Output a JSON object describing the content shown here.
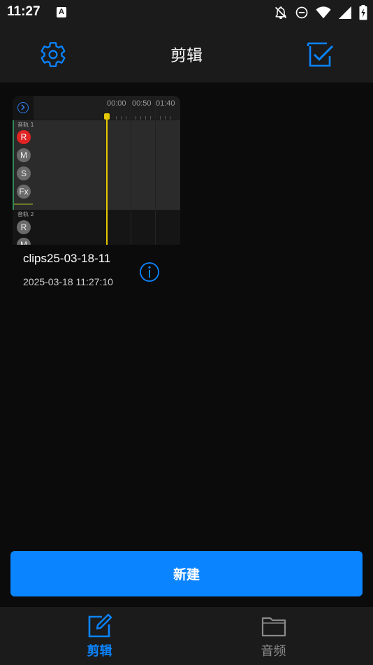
{
  "status_bar": {
    "time": "11:27",
    "notification_icon_letter": "A",
    "icons": [
      "notifications-off-icon",
      "do-not-disturb-icon",
      "wifi-icon",
      "signal-icon",
      "battery-charging-icon"
    ]
  },
  "header": {
    "title": "剪辑",
    "left_icon": "settings-gear-icon",
    "right_icon": "select-multiple-icon"
  },
  "projects": [
    {
      "name": "clips25-03-18-11",
      "date": "2025-03-18 11:27:10",
      "thumbnail": {
        "ruler_labels": [
          "00:00",
          "00:50",
          "01:40"
        ],
        "track1_label": "音轨 1",
        "track2_label": "音轨 2",
        "track1_buttons": [
          "R",
          "M",
          "S",
          "Fx"
        ],
        "track2_buttons": [
          "R",
          "M"
        ]
      }
    }
  ],
  "actions": {
    "new_label": "新建"
  },
  "bottom_nav": [
    {
      "label": "剪辑",
      "icon": "edit-icon",
      "active": true
    },
    {
      "label": "音频",
      "icon": "folder-icon",
      "active": false
    }
  ],
  "colors": {
    "accent": "#0a84ff",
    "background": "#0b0b0b",
    "bar_background": "#1b1b1b",
    "record_red": "#e02424",
    "playhead_yellow": "#e6c800"
  }
}
